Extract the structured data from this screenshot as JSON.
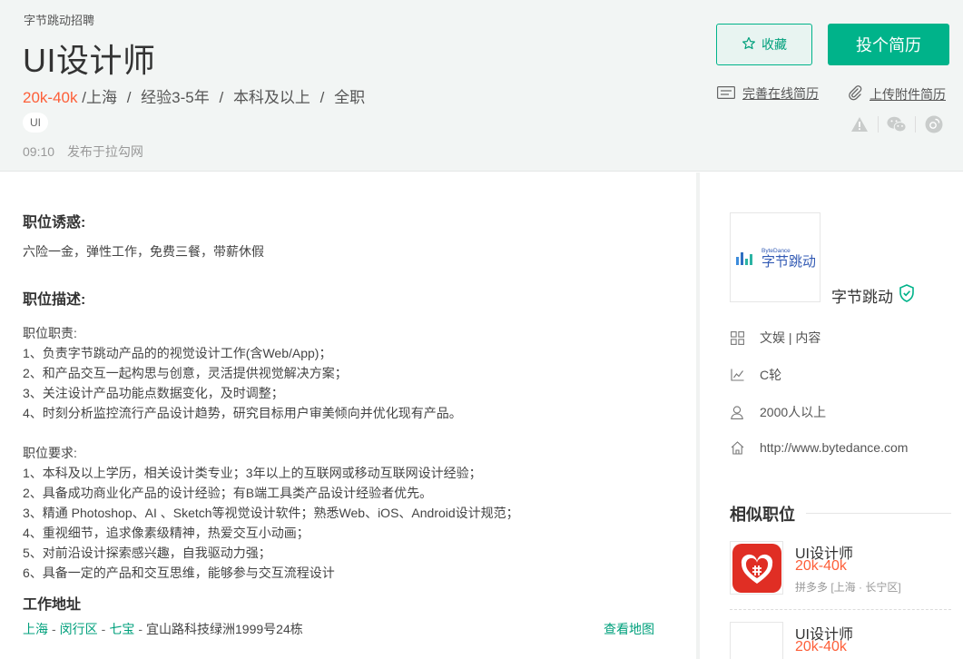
{
  "header": {
    "company": "字节跳动招聘",
    "title": "UI设计师",
    "salary": "20k-40k",
    "meta": [
      "/上海",
      "经验3-5年",
      "本科及以上",
      "全职"
    ],
    "tag": "UI",
    "time": "09:10",
    "published": "发布于拉勾网",
    "fav_label": "收藏",
    "apply_label": "投个简历",
    "online_resume": "完善在线简历",
    "attach_resume": "上传附件简历"
  },
  "main": {
    "perks_title": "职位诱惑:",
    "perks": "六险一金，弹性工作，免费三餐，带薪休假",
    "desc_title": "职位描述:",
    "desc": "职位职责:\n1、负责字节跳动产品的的视觉设计工作(含Web/App)；\n2、和产品交互一起构思与创意，灵活提供视觉解决方案；\n3、关注设计产品功能点数据变化，及时调整；\n4、时刻分析监控流行产品设计趋势，研究目标用户审美倾向并优化现有产品。\n\n职位要求:\n1、本科及以上学历，相关设计类专业；3年以上的互联网或移动互联网设计经验；\n2、具备成功商业化产品的设计经验；有B端工具类产品设计经验者优先。\n3、精通 Photoshop、AI 、Sketch等视觉设计软件；熟悉Web、iOS、Android设计规范；\n4、重视细节，追求像素级精神，热爱交互小动画；\n5、对前沿设计探索感兴趣，自我驱动力强；\n6、具备一定的产品和交互思维，能够参与交互流程设计",
    "address_title": "工作地址",
    "address": {
      "city": "上海",
      "district": "闵行区",
      "area": "七宝",
      "street": "宜山路科技绿洲1999号24栋",
      "map_link": "查看地图"
    }
  },
  "sidebar": {
    "logo_small": "ByteDance",
    "logo_text": "字节跳动",
    "company": "字节跳动",
    "info": {
      "field": "文娱 | 内容",
      "stage": "C轮",
      "size": "2000人以上",
      "website": "http://www.bytedance.com"
    },
    "similar_title": "相似职位",
    "similar": [
      {
        "title": "UI设计师",
        "salary": "20k-40k",
        "company": "拼多多 [上海 · 长宁区]"
      },
      {
        "title": "UI设计师",
        "salary": "20k-40k"
      }
    ]
  },
  "colors": {
    "brand_green": "#00b38a",
    "salary_orange": "#fd5f39",
    "header_bg": "#f2f5f4"
  }
}
